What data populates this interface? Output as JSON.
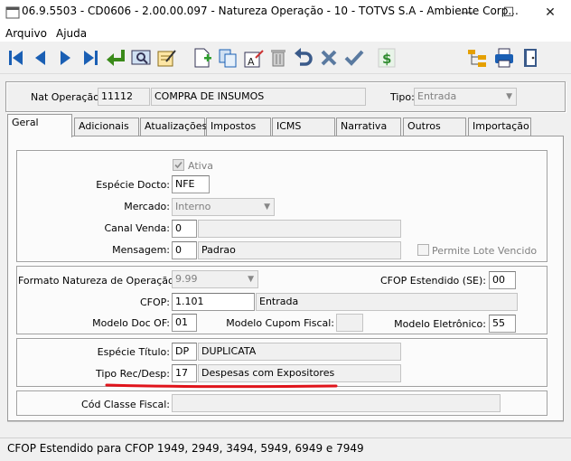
{
  "window": {
    "title": "06.9.5503 - CD0606 - 2.00.00.097 - Natureza Operação - 10 - TOTVS S.A - Ambiente Corp...",
    "minimize": "—",
    "maximize": "☐",
    "close": "✕"
  },
  "menu": {
    "items": [
      "Arquivo",
      "Ajuda"
    ]
  },
  "toolbar": {
    "icons": [
      "first-record-icon",
      "prev-record-icon",
      "next-record-icon",
      "last-record-icon",
      "goto-icon",
      "search-icon",
      "list-icon",
      "new-icon",
      "copy-icon",
      "edit-icon",
      "delete-icon",
      "undo-icon",
      "cancel-icon",
      "save-icon",
      "money-icon",
      "hierarchy-icon",
      "print-icon",
      "exit-icon"
    ]
  },
  "header": {
    "nat_label": "Nat Operação:",
    "nat_code": "11112",
    "nat_desc": "COMPRA DE INSUMOS",
    "tipo_label": "Tipo:",
    "tipo_value": "Entrada"
  },
  "tabs": [
    "Geral",
    "Adicionais",
    "Atualizações",
    "Impostos",
    "ICMS",
    "Narrativa",
    "Outros",
    "Importação"
  ],
  "geral": {
    "ativa_label": "Ativa",
    "especie_label": "Espécie Docto:",
    "especie_value": "NFE",
    "mercado_label": "Mercado:",
    "mercado_value": "Interno",
    "canal_label": "Canal Venda:",
    "canal_code": "0",
    "canal_desc": "",
    "mensagem_label": "Mensagem:",
    "mensagem_code": "0",
    "mensagem_desc": "Padrao",
    "lote_label": "Permite Lote Vencido",
    "formato_label": "Formato Natureza de Operação:",
    "formato_value": "9.99",
    "cfop_se_label": "CFOP Estendido (SE):",
    "cfop_se_value": "00",
    "cfop_label": "CFOP:",
    "cfop_code": "1.101",
    "cfop_desc": "Entrada",
    "modelo_of_label": "Modelo Doc OF:",
    "modelo_of_value": "01",
    "modelo_cupom_label": "Modelo Cupom Fiscal:",
    "modelo_cupom_value": "",
    "modelo_elet_label": "Modelo Eletrônico:",
    "modelo_elet_value": "55",
    "especie_titulo_label": "Espécie Título:",
    "especie_titulo_code": "DP",
    "especie_titulo_desc": "DUPLICATA",
    "tipo_rec_label": "Tipo Rec/Desp:",
    "tipo_rec_code": "17",
    "tipo_rec_desc": "Despesas com Expositores",
    "classe_label": "Cód Classe Fiscal:",
    "classe_value": ""
  },
  "status": {
    "text": "CFOP Estendido para CFOP 1949, 2949, 3494, 5949, 6949 e 7949"
  },
  "colors": {
    "highlight": "#e0141b",
    "accent": "#1a5fb4"
  }
}
